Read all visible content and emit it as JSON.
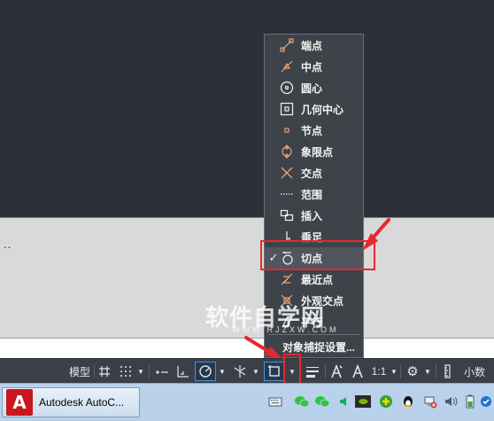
{
  "snap_menu": {
    "items": [
      {
        "label": "端点",
        "icon": "endpoint-icon",
        "checked": false
      },
      {
        "label": "中点",
        "icon": "midpoint-icon",
        "checked": false
      },
      {
        "label": "圆心",
        "icon": "center-icon",
        "checked": false
      },
      {
        "label": "几何中心",
        "icon": "geometric-center-icon",
        "checked": false
      },
      {
        "label": "节点",
        "icon": "node-icon",
        "checked": false
      },
      {
        "label": "象限点",
        "icon": "quadrant-icon",
        "checked": false
      },
      {
        "label": "交点",
        "icon": "intersection-icon",
        "checked": false
      },
      {
        "label": "范围",
        "icon": "extension-icon",
        "checked": false
      },
      {
        "label": "插入",
        "icon": "insertion-icon",
        "checked": false
      },
      {
        "label": "垂足",
        "icon": "perpendicular-icon",
        "checked": false
      },
      {
        "label": "切点",
        "icon": "tangent-icon",
        "checked": true
      },
      {
        "label": "最近点",
        "icon": "nearest-icon",
        "checked": false
      },
      {
        "label": "外观交点",
        "icon": "apparent-intersection-icon",
        "checked": false
      },
      {
        "label": "平行",
        "icon": "parallel-icon",
        "checked": false
      }
    ],
    "check_mark": "✓",
    "settings_label": "对象捕捉设置..."
  },
  "command_history": "..",
  "statusbar": {
    "model_label": "模型",
    "scale_label": "1:1",
    "units_label": "小数"
  },
  "taskbar": {
    "app_label": "Autodesk AutoC...",
    "app_logo_letter": "A"
  },
  "watermark": {
    "text": "软件自学网",
    "sub": "WWW.RJZXW.COM"
  },
  "colors": {
    "menu_bg": "#3e4249",
    "icon_stroke": "#e8a27a",
    "highlight_red": "#e8262e",
    "statusbar_active": "#4a90d9"
  }
}
